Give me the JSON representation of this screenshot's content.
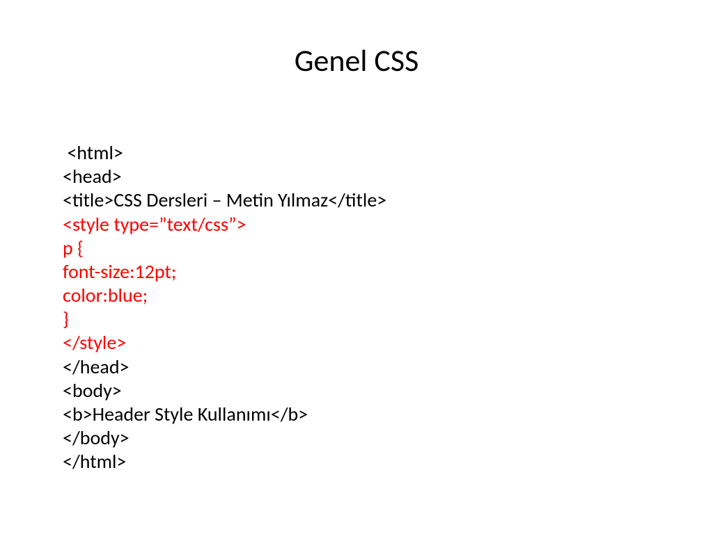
{
  "title": "Genel CSS",
  "code": {
    "l1": " <html>",
    "l2": "<head>",
    "l3": "<title>CSS Dersleri – Metin Yılmaz</title>",
    "l4": "<style type=”text/css”>",
    "l5": "p {",
    "l6": "font-size:12pt;",
    "l7": "color:blue;",
    "l8": "}",
    "l9": "</style>",
    "l10": "</head>",
    "l11": "<body>",
    "l12": "<b>Header Style Kullanımı</b>",
    "l13": "</body>",
    "l14": "</html>"
  }
}
